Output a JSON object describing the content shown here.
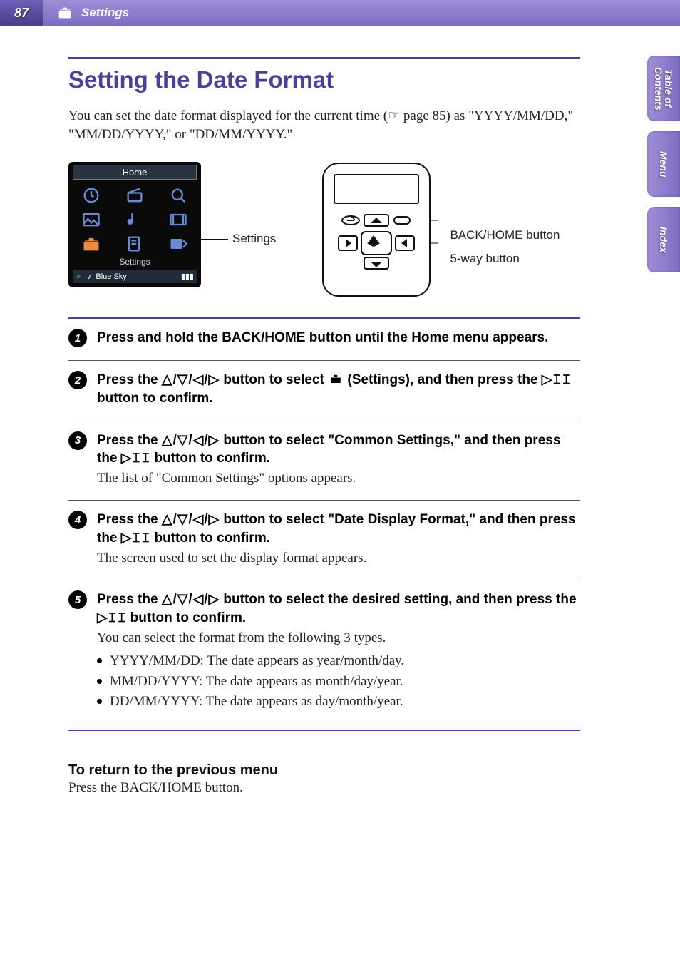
{
  "header": {
    "page_number": "87",
    "section": "Settings"
  },
  "side_tabs": {
    "toc_line1": "Table of",
    "toc_line2": "Contents",
    "menu": "Menu",
    "index": "Index"
  },
  "title": "Setting the Date Format",
  "intro": "You can set the date format displayed for the current time (☞ page 85) as \"YYYY/MM/DD,\" \"MM/DD/YYYY,\" or \"DD/MM/YYYY.\"",
  "home_screen": {
    "title": "Home",
    "settings_label": "Settings",
    "now_playing": "Blue Sky"
  },
  "figure_labels": {
    "settings": "Settings",
    "back_home": "BACK/HOME button",
    "five_way": "5-way button"
  },
  "steps": [
    {
      "num": "1",
      "title": "Press and hold the BACK/HOME button until the Home menu appears."
    },
    {
      "num": "2",
      "title_pre": "Press the ",
      "title_mid": " button to select ",
      "title_post": " (Settings), and then press the ",
      "title_end": " button to confirm."
    },
    {
      "num": "3",
      "title_pre": "Press the ",
      "title_mid": " button to select \"Common Settings,\" and then press the ",
      "title_end": " button to confirm.",
      "desc": "The list of \"Common Settings\" options appears."
    },
    {
      "num": "4",
      "title_pre": "Press the ",
      "title_mid": " button to select \"Date Display Format,\" and then press the ",
      "title_end": " button to confirm.",
      "desc": "The screen used to set the display format appears."
    },
    {
      "num": "5",
      "title_pre": "Press the ",
      "title_mid": " button to select the desired setting, and then press the ",
      "title_end": " button to confirm.",
      "desc": "You can select the format from the following 3 types.",
      "bullets": [
        "YYYY/MM/DD: The date appears as year/month/day.",
        "MM/DD/YYYY: The date appears as month/day/year.",
        "DD/MM/YYYY: The date appears as day/month/year."
      ]
    }
  ],
  "return": {
    "heading": "To return to the previous menu",
    "body": "Press the BACK/HOME button."
  },
  "glyphs": {
    "arrows": "△/▽/◁/▷",
    "play_pause": "▷𝙸𝙸"
  }
}
